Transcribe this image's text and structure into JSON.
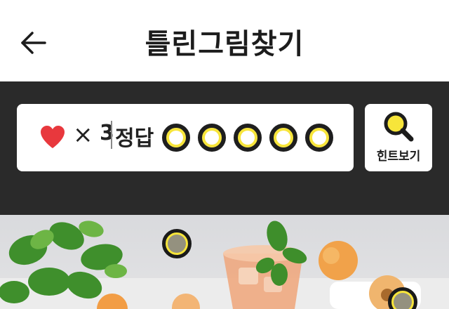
{
  "header": {
    "title": "틀린그림찾기",
    "back_icon": "arrow-left-icon"
  },
  "status": {
    "life_icon": "heart-icon",
    "times_symbol": "×",
    "life_count": "3",
    "answer_label": "정답",
    "answer_slots": 5,
    "found": 0
  },
  "hint": {
    "label": "힌트보기",
    "icon": "magnifier-icon"
  },
  "colors": {
    "accent_yellow": "#f7e53a",
    "heart_red": "#e8383d",
    "status_bg": "#2a2a2a"
  },
  "photo": {
    "subject": "peach iced tea with mint",
    "found_markers": 2
  }
}
